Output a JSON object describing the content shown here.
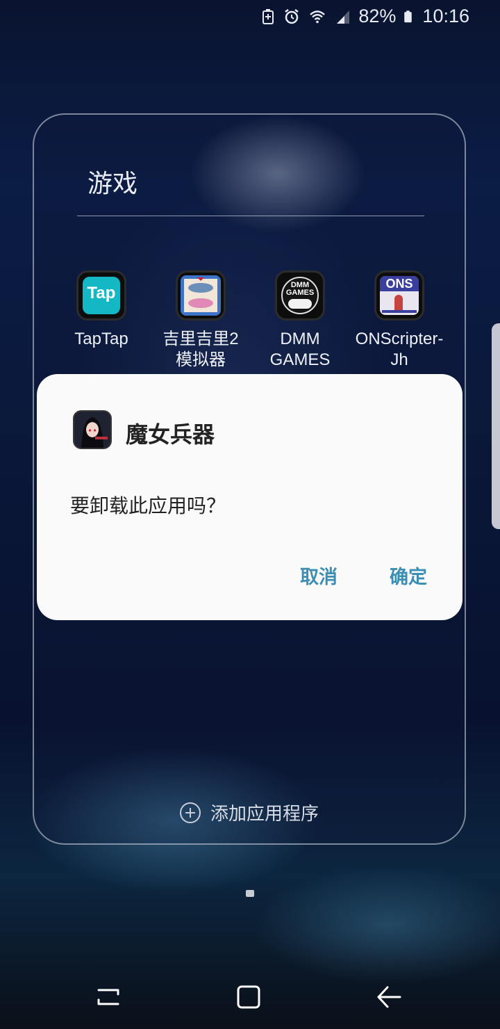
{
  "status_bar": {
    "battery_percent": "82%",
    "time": "10:16",
    "icons": [
      "battery-saver-icon",
      "alarm-icon",
      "wifi-icon",
      "signal-icon",
      "battery-icon"
    ]
  },
  "folder": {
    "title": "游戏",
    "apps": [
      {
        "label": "TapTap",
        "icon": "taptap-app-icon"
      },
      {
        "label": "吉里吉里2\n模拟器",
        "icon": "kirikiri2-app-icon"
      },
      {
        "label": "DMM\nGAMES",
        "icon": "dmm-games-app-icon"
      },
      {
        "label": "ONScripter-\nJh",
        "icon": "onscripter-app-icon"
      }
    ],
    "add_apps_label": "添加应用程序"
  },
  "dialog": {
    "app_name": "魔女兵器",
    "message": "要卸载此应用吗？",
    "cancel_label": "取消",
    "confirm_label": "确定",
    "accent_color": "#3c8fb3"
  },
  "icons": {
    "taptap_text": "Tap",
    "dmm_text_1": "DMM",
    "dmm_text_2": "GAMES",
    "ons_text": "ONS"
  },
  "navigation": {
    "buttons": [
      "recents-icon",
      "home-icon",
      "back-icon"
    ]
  }
}
